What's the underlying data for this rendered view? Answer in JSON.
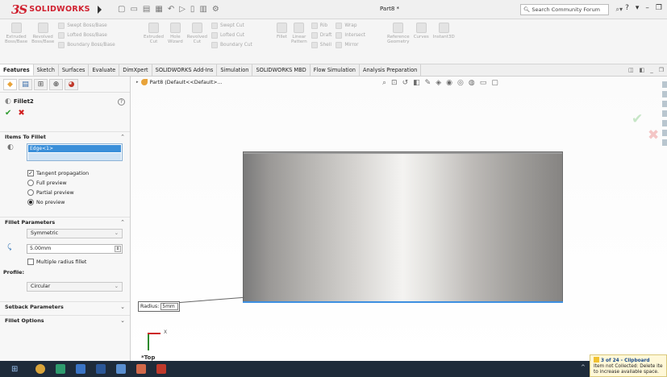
{
  "app": {
    "brand": "SOLIDWORKS",
    "brand_mark": "3S",
    "document_title": "Part8 *",
    "search_placeholder": "Search Community Forum",
    "help_glyph": "?"
  },
  "ribbon": {
    "group1": [
      {
        "label": "Extruded\nBoss/Base",
        "icon": "extruded-boss-icon"
      },
      {
        "label": "Revolved\nBoss/Base",
        "icon": "revolved-boss-icon"
      }
    ],
    "group1_small": [
      "Swept Boss/Base",
      "Lofted Boss/Base",
      "Boundary Boss/Base"
    ],
    "group2": [
      {
        "label": "Extruded\nCut",
        "icon": "extruded-cut-icon"
      },
      {
        "label": "Hole\nWizard",
        "icon": "hole-wizard-icon"
      },
      {
        "label": "Revolved\nCut",
        "icon": "revolved-cut-icon"
      }
    ],
    "group2_small": [
      "Swept Cut",
      "Lofted Cut",
      "Boundary Cut"
    ],
    "group3": [
      {
        "label": "Fillet",
        "icon": "fillet-icon"
      },
      {
        "label": "Linear\nPattern",
        "icon": "linear-pattern-icon"
      }
    ],
    "group3_small": [
      "Rib",
      "Draft",
      "Shell"
    ],
    "group4_small": [
      "Wrap",
      "Intersect",
      "Mirror"
    ],
    "group5": [
      {
        "label": "Reference\nGeometry",
        "icon": "reference-geometry-icon"
      },
      {
        "label": "Curves",
        "icon": "curves-icon"
      },
      {
        "label": "Instant3D",
        "icon": "instant3d-icon"
      }
    ]
  },
  "tabs": [
    "Features",
    "Sketch",
    "Surfaces",
    "Evaluate",
    "DimXpert",
    "SOLIDWORKS Add-Ins",
    "Simulation",
    "SOLIDWORKS MBD",
    "Flow Simulation",
    "Analysis Preparation"
  ],
  "property_manager": {
    "title": "Fillet2",
    "items_to_fillet": {
      "header": "Items To Fillet",
      "selected_edge": "Edge<1>",
      "tangent_propagation": "Tangent propagation",
      "full_preview": "Full preview",
      "partial_preview": "Partial preview",
      "no_preview": "No preview",
      "selected_preview": "No preview",
      "tangent_checked": true
    },
    "fillet_parameters": {
      "header": "Fillet Parameters",
      "method": "Symmetric",
      "radius": "5.00mm",
      "multiple_radius": "Multiple radius fillet",
      "profile_label": "Profile:",
      "profile": "Circular"
    },
    "setback_parameters": "Setback Parameters",
    "fillet_options": "Fillet Options"
  },
  "viewport": {
    "tree_root": "Part8  (Default<<Default>...",
    "radius_label": "Radius:",
    "radius_value": "5mm",
    "view_label": "*Top",
    "triad_x": "X"
  },
  "notification": {
    "title": "3 of 24 - Clipboard",
    "line1": "Item not Collected: Delete ite",
    "line2": "to increase available space."
  },
  "colors": {
    "brand_red": "#d0202f",
    "selection_blue": "#3a8fd9",
    "ok_green": "#2e9b2e",
    "cancel_red": "#d02020",
    "edge_highlight": "#3d8fe0",
    "taskbar": "#1e2b3a"
  }
}
